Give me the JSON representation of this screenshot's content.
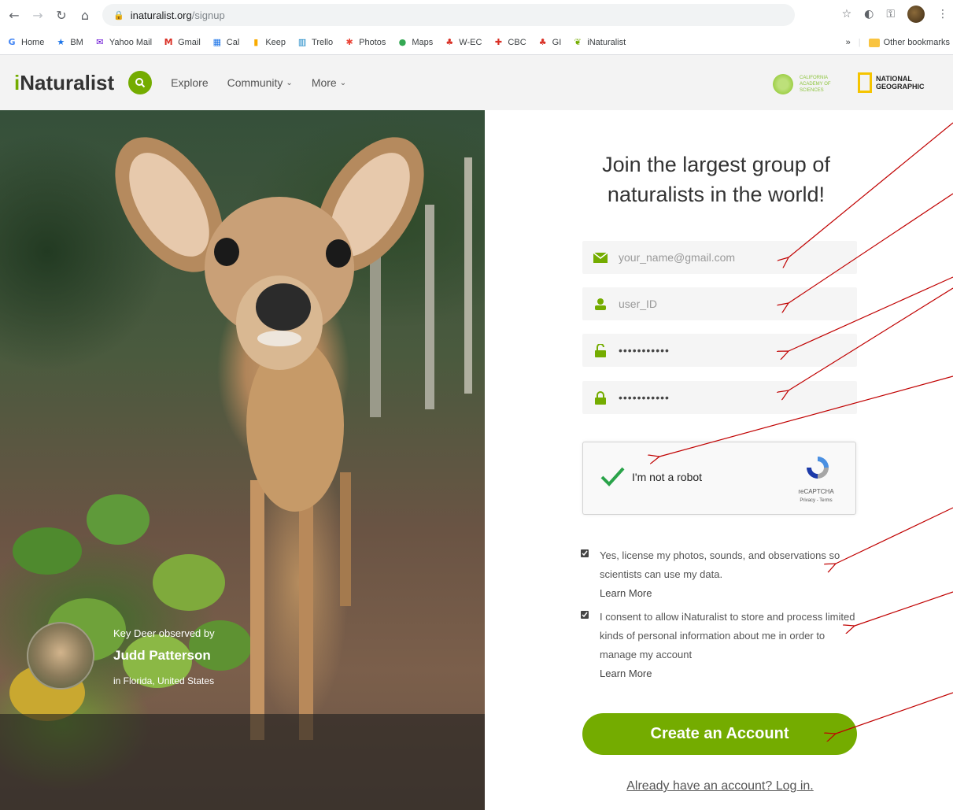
{
  "browser": {
    "url_host": "inaturalist.org",
    "url_path": "/signup",
    "bookmarks": [
      {
        "label": "Home",
        "icon": "G",
        "color": "#4285f4"
      },
      {
        "label": "BM",
        "icon": "★",
        "color": "#1a73e8"
      },
      {
        "label": "Yahoo Mail",
        "icon": "✉",
        "color": "#6001d2"
      },
      {
        "label": "Gmail",
        "icon": "M",
        "color": "#d93025"
      },
      {
        "label": "Cal",
        "icon": "▦",
        "color": "#1a73e8"
      },
      {
        "label": "Keep",
        "icon": "▮",
        "color": "#f9ab00"
      },
      {
        "label": "Trello",
        "icon": "▥",
        "color": "#0079bf"
      },
      {
        "label": "Photos",
        "icon": "✱",
        "color": "#ea4335"
      },
      {
        "label": "Maps",
        "icon": "●",
        "color": "#34a853"
      },
      {
        "label": "W-EC",
        "icon": "♣",
        "color": "#d93025"
      },
      {
        "label": "CBC",
        "icon": "✚",
        "color": "#d93025"
      },
      {
        "label": "GI",
        "icon": "♣",
        "color": "#d93025"
      },
      {
        "label": "iNaturalist",
        "icon": "❦",
        "color": "#74ac00"
      }
    ],
    "overflow_label": "»",
    "other_bookmarks": "Other bookmarks"
  },
  "header": {
    "logo_i": "i",
    "logo_rest": "Naturalist",
    "nav": {
      "explore": "Explore",
      "community": "Community",
      "more": "More"
    },
    "partner_cas": "CALIFORNIA ACADEMY OF SCIENCES",
    "partner_ng_line1": "NATIONAL",
    "partner_ng_line2": "GEOGRAPHIC",
    "accent": "#74ac00"
  },
  "photo": {
    "caption_line1": "Key Deer observed by",
    "observer": "Judd Patterson",
    "place": "in Florida, United States"
  },
  "form": {
    "title_line1": "Join the largest group of",
    "title_line2": "naturalists in the world!",
    "email_value": "your_name@gmail.com",
    "username_value": "user_ID",
    "password_value": "•••••••••••",
    "password_confirm_value": "•••••••••••",
    "captcha_label": "I'm not a robot",
    "captcha_brand": "reCAPTCHA",
    "captcha_terms": "Privacy - Terms",
    "license_text": "Yes, license my photos, sounds, and observations so scientists can use my data.",
    "license_learn": "Learn More",
    "consent_text": "I consent to allow iNaturalist to store and process limited kinds of personal information about me in order to manage my account",
    "consent_learn": "Learn More",
    "create_button": "Create an Account",
    "login_link": "Already have an account? Log in."
  },
  "annotation_color": "#c00000"
}
